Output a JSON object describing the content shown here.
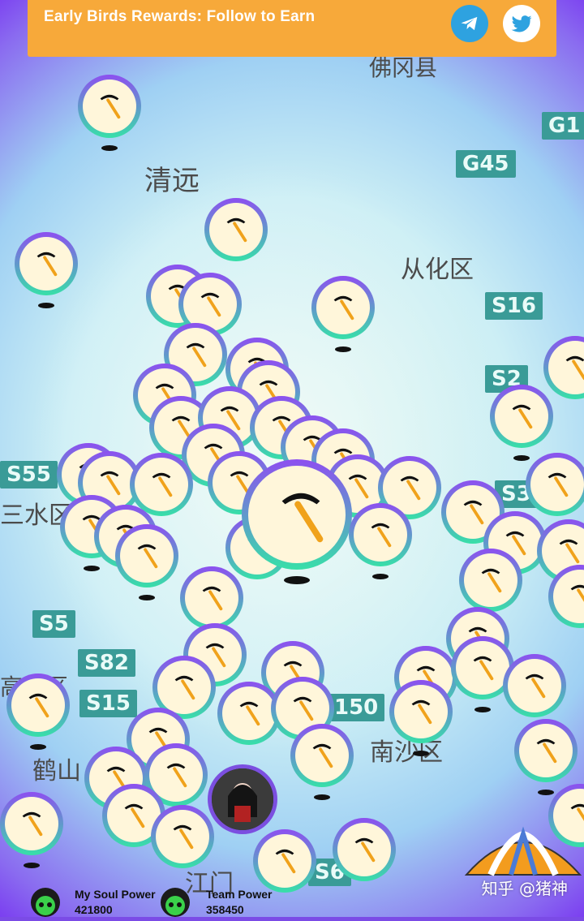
{
  "banner": {
    "text": "Early Birds Rewards: Follow to Earn",
    "icons": [
      "telegram-icon",
      "twitter-icon"
    ]
  },
  "map": {
    "places": [
      "清远",
      "从化区",
      "三水区",
      "南沙区",
      "鹤山",
      "佛冈县",
      "江门",
      "高明区"
    ],
    "roads": [
      "G45",
      "G1",
      "S16",
      "S2",
      "S55",
      "S5",
      "S82",
      "S15",
      "150",
      "S35",
      "S6"
    ]
  },
  "stats": {
    "soul_label": "My Soul Power",
    "soul_value": "421800",
    "team_label": "Team Power",
    "team_value": "358450"
  },
  "watermark": "知乎 @猪神",
  "colors": {
    "banner": "#f7a93a",
    "accent_purple": "#8d4ff0",
    "accent_green": "#37e0a8"
  }
}
